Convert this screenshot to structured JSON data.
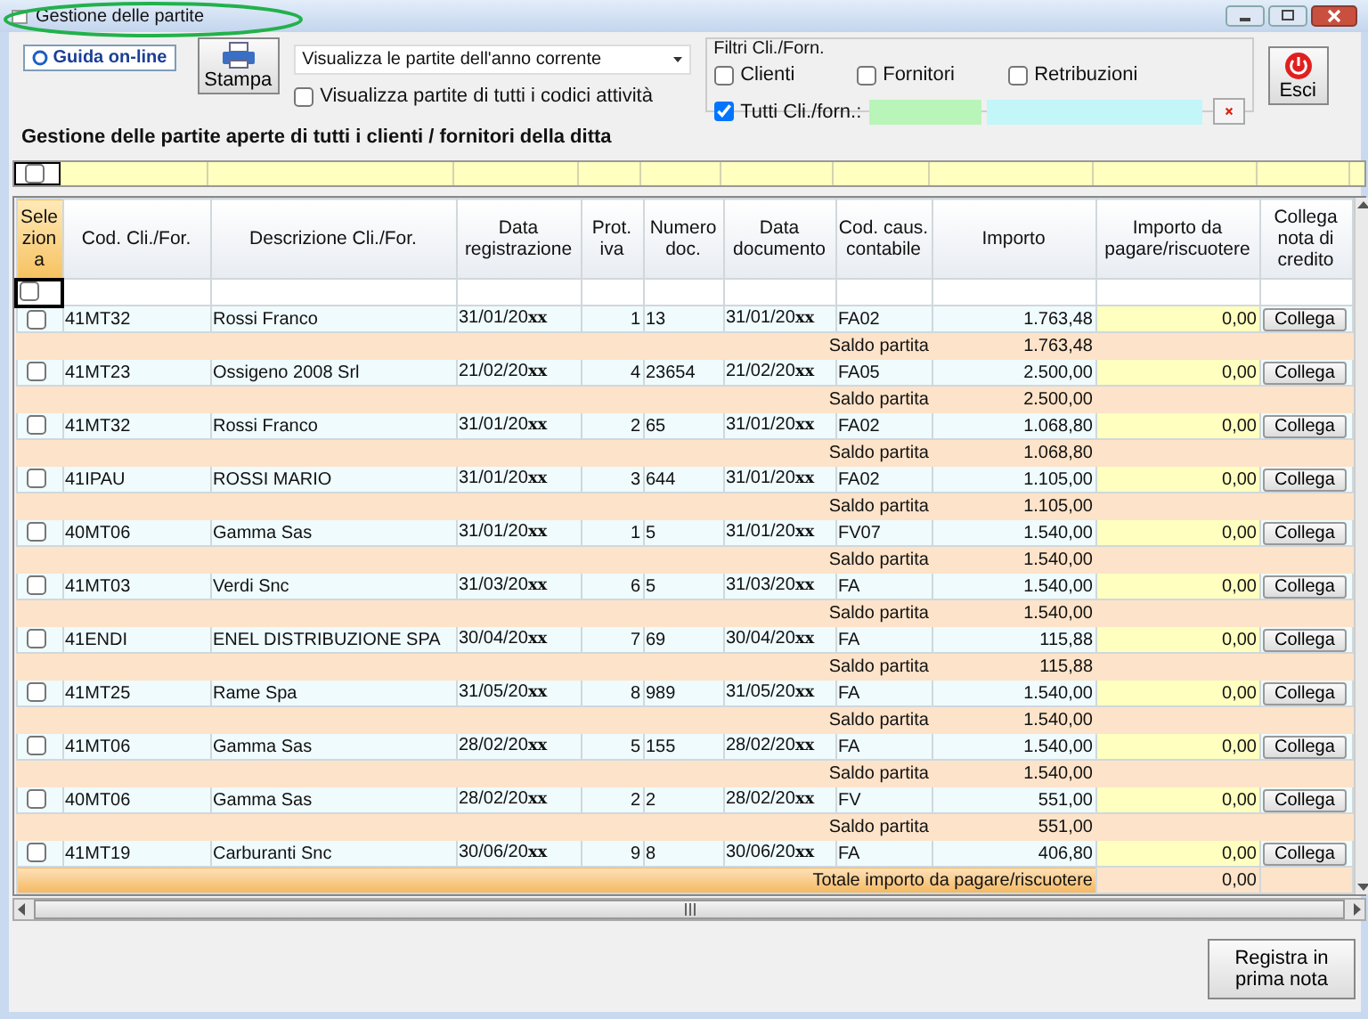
{
  "window": {
    "title": "Gestione delle partite"
  },
  "toolbar": {
    "help_button": "Guida on-line",
    "print_button": "Stampa",
    "period_select": {
      "value": "Visualizza le partite dell'anno corrente"
    },
    "all_activities": {
      "label": "Visualizza partite di tutti i codici attività",
      "checked": false
    }
  },
  "filters": {
    "title": "Filtri Cli./Forn.",
    "options": [
      {
        "label": "Clienti",
        "checked": false
      },
      {
        "label": "Fornitori",
        "checked": false
      },
      {
        "label": "Retribuzioni",
        "checked": false
      }
    ],
    "all": {
      "label": "Tutti Cli./forn.:",
      "checked": true
    }
  },
  "exit_button": "Esci",
  "heading": "Gestione delle partite aperte di tutti i clienti / fornitori della ditta",
  "filter_row_checkbox": {
    "checked": false
  },
  "header_checkbox": {
    "checked": false
  },
  "table": {
    "columns": [
      "Sele zion a",
      "Cod. Cli./For.",
      "Descrizione Cli./For.",
      "Data registrazione",
      "Prot. iva",
      "Numero doc.",
      "Data documento",
      "Cod. caus. contabile",
      "Importo",
      "Importo da pagare/riscuotere",
      "Collega nota di credito"
    ],
    "rows": [
      {
        "selected": false,
        "code": "41MT32",
        "description": "Rossi Franco",
        "reg_date": "31/01/20**xx**",
        "prot": "1",
        "doc_number": "13",
        "doc_date": "31/01/20**xx**",
        "causal": "FA02",
        "amount": "1.763,48",
        "to_pay": "0,00",
        "link_button": "Collega",
        "balance_label": "Saldo partita",
        "balance": "1.763,48"
      },
      {
        "selected": false,
        "code": "41MT23",
        "description": "Ossigeno 2008 Srl",
        "reg_date": "21/02/20**xx**",
        "prot": "4",
        "doc_number": "23654",
        "doc_date": "21/02/20**xx**",
        "causal": "FA05",
        "amount": "2.500,00",
        "to_pay": "0,00",
        "link_button": "Collega",
        "balance_label": "Saldo partita",
        "balance": "2.500,00"
      },
      {
        "selected": false,
        "code": "41MT32",
        "description": "Rossi Franco",
        "reg_date": "31/01/20**xx**",
        "prot": "2",
        "doc_number": "65",
        "doc_date": "31/01/20**xx**",
        "causal": "FA02",
        "amount": "1.068,80",
        "to_pay": "0,00",
        "link_button": "Collega",
        "balance_label": "Saldo partita",
        "balance": "1.068,80"
      },
      {
        "selected": false,
        "code": "41IPAU",
        "description": "ROSSI MARIO",
        "reg_date": "31/01/20**xx**",
        "prot": "3",
        "doc_number": "644",
        "doc_date": "31/01/20**xx**",
        "causal": "FA02",
        "amount": "1.105,00",
        "to_pay": "0,00",
        "link_button": "Collega",
        "balance_label": "Saldo partita",
        "balance": "1.105,00"
      },
      {
        "selected": false,
        "code": "40MT06",
        "description": "Gamma Sas",
        "reg_date": "31/01/20**xx**",
        "prot": "1",
        "doc_number": "5",
        "doc_date": "31/01/20**xx**",
        "causal": "FV07",
        "amount": "1.540,00",
        "to_pay": "0,00",
        "link_button": "Collega",
        "balance_label": "Saldo partita",
        "balance": "1.540,00"
      },
      {
        "selected": false,
        "code": "41MT03",
        "description": "Verdi Snc",
        "reg_date": "31/03/20**xx**",
        "prot": "6",
        "doc_number": "5",
        "doc_date": "31/03/20**xx**",
        "causal": "FA",
        "amount": "1.540,00",
        "to_pay": "0,00",
        "link_button": "Collega",
        "balance_label": "Saldo partita",
        "balance": "1.540,00"
      },
      {
        "selected": false,
        "code": "41ENDI",
        "description": "ENEL DISTRIBUZIONE SPA",
        "reg_date": "30/04/20**xx**",
        "prot": "7",
        "doc_number": "69",
        "doc_date": "30/04/20**xx**",
        "causal": "FA",
        "amount": "115,88",
        "to_pay": "0,00",
        "link_button": "Collega",
        "balance_label": "Saldo partita",
        "balance": "115,88"
      },
      {
        "selected": false,
        "code": "41MT25",
        "description": "Rame Spa",
        "reg_date": "31/05/20**xx**",
        "prot": "8",
        "doc_number": "989",
        "doc_date": "31/05/20**xx**",
        "causal": "FA",
        "amount": "1.540,00",
        "to_pay": "0,00",
        "link_button": "Collega",
        "balance_label": "Saldo partita",
        "balance": "1.540,00"
      },
      {
        "selected": false,
        "code": "41MT06",
        "description": "Gamma Sas",
        "reg_date": "28/02/20**xx**",
        "prot": "5",
        "doc_number": "155",
        "doc_date": "28/02/20**xx**",
        "causal": "FA",
        "amount": "1.540,00",
        "to_pay": "0,00",
        "link_button": "Collega",
        "balance_label": "Saldo partita",
        "balance": "1.540,00"
      },
      {
        "selected": false,
        "code": "40MT06",
        "description": "Gamma Sas",
        "reg_date": "28/02/20**xx**",
        "prot": "2",
        "doc_number": "2",
        "doc_date": "28/02/20**xx**",
        "causal": "FV",
        "amount": "551,00",
        "to_pay": "0,00",
        "link_button": "Collega",
        "balance_label": "Saldo partita",
        "balance": "551,00"
      },
      {
        "selected": false,
        "code": "41MT19",
        "description": "Carburanti Snc",
        "reg_date": "30/06/20**xx**",
        "prot": "9",
        "doc_number": "8",
        "doc_date": "30/06/20**xx**",
        "causal": "FA",
        "amount": "406,80",
        "to_pay": "0,00",
        "link_button": "Collega"
      }
    ],
    "total_label": "Totale importo da pagare/riscuotere",
    "total": "0,00"
  },
  "register_button": "Registra in prima nota"
}
